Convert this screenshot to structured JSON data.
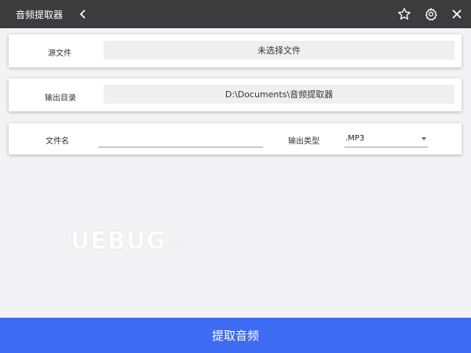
{
  "titlebar": {
    "app_title": "音频提取器",
    "icons": [
      "back-icon",
      "star-icon",
      "gear-icon",
      "close-icon"
    ]
  },
  "source": {
    "label": "源文件",
    "value": "未选择文件"
  },
  "output_dir": {
    "label": "输出目录",
    "value": "D:\\Documents\\音频提取器"
  },
  "file": {
    "name_label": "文件名",
    "name_value": "",
    "type_label": "输出类型",
    "type_value": ".MP3"
  },
  "watermark": {
    "text": "UEBUG",
    "suffix": ".com"
  },
  "action": {
    "extract_label": "提取音频"
  },
  "colors": {
    "titlebar": "#3c3c3c",
    "accent": "#3d6bf3",
    "background": "#f3f3f6"
  }
}
